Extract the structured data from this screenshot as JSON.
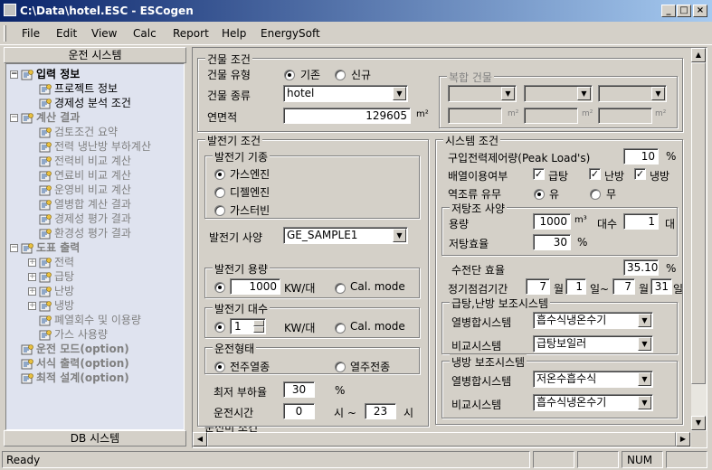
{
  "window": {
    "title": "C:\\Data\\hotel.ESC - ESCogen",
    "min": "_",
    "max": "□",
    "close": "×"
  },
  "menu": [
    "File",
    "Edit",
    "View",
    "Calc",
    "Report",
    "Help",
    "EnergySoft"
  ],
  "left_panel": {
    "header": "운전 시스템",
    "footer": "DB 시스템",
    "tree": [
      {
        "label": "입력 정보",
        "level": 0,
        "bold": true,
        "expander": "−",
        "gray": false
      },
      {
        "label": "프로젝트 정보",
        "level": 1,
        "bold": false,
        "gray": false
      },
      {
        "label": "경제성 분석 조건",
        "level": 1,
        "bold": false,
        "gray": false
      },
      {
        "label": "계산 결과",
        "level": 0,
        "bold": true,
        "expander": "−",
        "gray": true
      },
      {
        "label": "검토조건 요약",
        "level": 1,
        "bold": false,
        "gray": true
      },
      {
        "label": "전력 냉난방 부하계산",
        "level": 1,
        "bold": false,
        "gray": true
      },
      {
        "label": "전력비 비교 계산",
        "level": 1,
        "bold": false,
        "gray": true
      },
      {
        "label": "연료비 비교 계산",
        "level": 1,
        "bold": false,
        "gray": true
      },
      {
        "label": "운영비 비교 계산",
        "level": 1,
        "bold": false,
        "gray": true
      },
      {
        "label": "열병합 계산 결과",
        "level": 1,
        "bold": false,
        "gray": true
      },
      {
        "label": "경제성 평가 결과",
        "level": 1,
        "bold": false,
        "gray": true
      },
      {
        "label": "환경성 평가 결과",
        "level": 1,
        "bold": false,
        "gray": true
      },
      {
        "label": "도표 출력",
        "level": 0,
        "bold": true,
        "expander": "−",
        "gray": true
      },
      {
        "label": "전력",
        "level": 1,
        "bold": false,
        "expander": "+",
        "gray": true
      },
      {
        "label": "급탕",
        "level": 1,
        "bold": false,
        "expander": "+",
        "gray": true
      },
      {
        "label": "난방",
        "level": 1,
        "bold": false,
        "expander": "+",
        "gray": true
      },
      {
        "label": "냉방",
        "level": 1,
        "bold": false,
        "expander": "+",
        "gray": true
      },
      {
        "label": "폐열회수 및 이용량",
        "level": 1,
        "bold": false,
        "gray": true
      },
      {
        "label": "가스 사용량",
        "level": 1,
        "bold": false,
        "gray": true
      },
      {
        "label": "운전 모드(option)",
        "level": 0,
        "bold": true,
        "gray": true
      },
      {
        "label": "서식 출력(option)",
        "level": 0,
        "bold": true,
        "gray": true
      },
      {
        "label": "최적 설계(option)",
        "level": 0,
        "bold": true,
        "gray": true
      }
    ]
  },
  "building": {
    "title": "건물 조건",
    "type_label": "건물 유형",
    "type_opt1": "기존",
    "type_opt2": "신규",
    "kind_label": "건물 종류",
    "kind_value": "hotel",
    "area_label": "연면적",
    "area_value": "129605",
    "area_unit": "m²",
    "complex_title": "복합 건물",
    "complex_unit": "m²"
  },
  "generator": {
    "title": "발전기 조건",
    "engine_title": "발전기 기종",
    "engine_opts": [
      "가스엔진",
      "디젤엔진",
      "가스터빈"
    ],
    "spec_label": "발전기 사양",
    "spec_value": "GE_SAMPLE1",
    "capacity_title": "발전기 용량",
    "capacity_value": "1000",
    "capacity_unit": "KW/대",
    "capacity_calmode": "Cal. mode",
    "count_title": "발전기 대수",
    "count_value": "1",
    "count_unit": "KW/대",
    "count_calmode": "Cal. mode",
    "op_title": "운전형태",
    "op_opt1": "전주열종",
    "op_opt2": "열주전종",
    "minload_label": "최저 부하율",
    "minload_value": "30",
    "minload_unit": "%",
    "optime_label": "운전시간",
    "optime_from": "0",
    "optime_sep": "시 ~",
    "optime_to": "23",
    "optime_unit": "시",
    "next_section": "운전비 조건"
  },
  "system": {
    "title": "시스템 조건",
    "peak_label": "구입전력제어량(Peak Load's)",
    "peak_value": "10",
    "peak_unit": "%",
    "heat_label": "배열이용여부",
    "heat_opts": [
      "급탕",
      "난방",
      "냉방"
    ],
    "reverse_label": "역조류 유무",
    "reverse_opt1": "유",
    "reverse_opt2": "무",
    "tank_title": "저탕조 사양",
    "tank_cap_label": "용량",
    "tank_cap_value": "1000",
    "tank_cap_unit": "m³",
    "tank_count_label": "대수",
    "tank_count_value": "1",
    "tank_count_unit": "대",
    "tank_eff_label": "저탕효율",
    "tank_eff_value": "30",
    "tank_eff_unit": "%",
    "trans_label": "수전단 효율",
    "trans_value": "35.10",
    "trans_unit": "%",
    "maint_label": "정기점검기간",
    "maint_m1": "7",
    "maint_d1": "1",
    "maint_m2": "7",
    "maint_d2": "31",
    "maint_month": "월",
    "maint_day_sep": "일~",
    "maint_day": "일",
    "aux_title": "급탕,난방 보조시스템",
    "aux_cogen_label": "열병합시스템",
    "aux_cogen_value": "흡수식냉온수기",
    "aux_comp_label": "비교시스템",
    "aux_comp_value": "급탕보일러",
    "cool_title": "냉방 보조시스템",
    "cool_cogen_label": "열병합시스템",
    "cool_cogen_value": "저온수흡수식",
    "cool_comp_label": "비교시스템",
    "cool_comp_value": "흡수식냉온수기"
  },
  "status": {
    "text": "Ready",
    "num": "NUM"
  }
}
